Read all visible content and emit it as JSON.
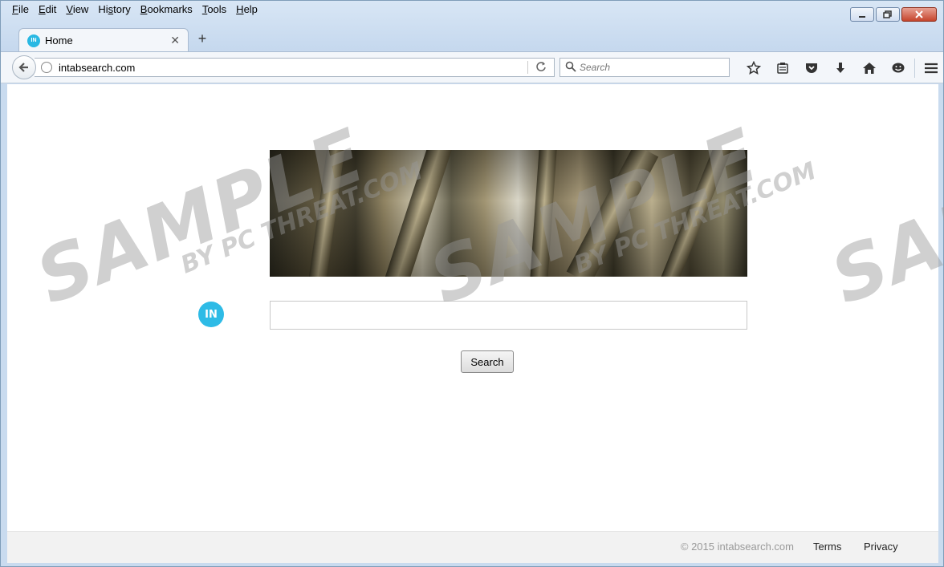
{
  "menu": {
    "items": [
      {
        "label": "File",
        "accel": "F"
      },
      {
        "label": "Edit",
        "accel": "E"
      },
      {
        "label": "View",
        "accel": "V"
      },
      {
        "label": "History",
        "accel": "s"
      },
      {
        "label": "Bookmarks",
        "accel": "B"
      },
      {
        "label": "Tools",
        "accel": "T"
      },
      {
        "label": "Help",
        "accel": "H"
      }
    ]
  },
  "tab": {
    "favicon_text": "IN",
    "title": "Home",
    "close_glyph": "✕",
    "new_tab_glyph": "+"
  },
  "navbar": {
    "url": "intabsearch.com",
    "search_placeholder": "Search"
  },
  "page": {
    "logo_text": "IN",
    "search_value": "",
    "search_button": "Search"
  },
  "footer": {
    "copyright": "© 2015 intabsearch.com",
    "terms": "Terms",
    "privacy": "Privacy"
  },
  "watermark": {
    "main": "SAMPLE",
    "sub": "BY PC THREAT.COM"
  },
  "colors": {
    "accent": "#2ebbe6",
    "chrome": "#c9dbef"
  }
}
